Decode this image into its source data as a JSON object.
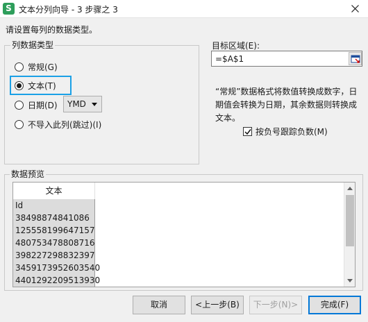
{
  "window": {
    "icon_letter": "S",
    "title": "文本分列向导 - 3 步骤之 3",
    "close_icon": "close-icon"
  },
  "instruction": "请设置每列的数据类型。",
  "column_type": {
    "legend": "列数据类型",
    "options": [
      {
        "label": "常规(G)",
        "checked": false
      },
      {
        "label": "文本(T)",
        "checked": true
      },
      {
        "label": "日期(D)",
        "checked": false
      },
      {
        "label": "不导入此列(跳过)(I)",
        "checked": false
      }
    ],
    "date_format": "YMD"
  },
  "target": {
    "label": "目标区域(E):",
    "value": "=$A$1"
  },
  "note": "“常规”数据格式将数值转换成数字，日期值会转换为日期，其余数据则转换成文本。",
  "negative_sign": {
    "label": "按负号跟踪负数(M)",
    "checked": true
  },
  "preview": {
    "legend": "数据预览",
    "header": "文本",
    "rows": [
      "Id",
      "38498874841086",
      "125558199647157",
      "480753478808716",
      "398227298832397",
      "3459173952603540",
      "4401292209513930"
    ]
  },
  "buttons": {
    "cancel": "取消",
    "back": "<上一步(B)",
    "next": "下一步(N)>",
    "finish": "完成(F)"
  },
  "colors": {
    "focus": "#1aa0e6",
    "app_icon": "#2e9e5b",
    "primary_border": "#0078d7"
  }
}
